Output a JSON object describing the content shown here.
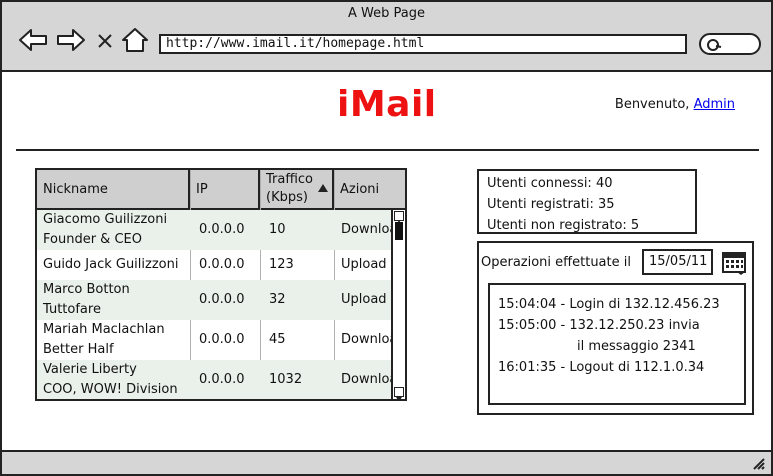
{
  "window": {
    "title": "A Web Page"
  },
  "browser": {
    "url": "http://www.imail.it/homepage.html",
    "icons": [
      "back-arrow-icon",
      "forward-arrow-icon",
      "close-x-icon",
      "home-icon",
      "search-icon"
    ]
  },
  "header": {
    "logo": "iMail",
    "welcome_prefix": "Benvenuto,",
    "user_link": "Admin",
    "logo_color": "#ee1111",
    "link_color": "#0000ee"
  },
  "table": {
    "columns": [
      "Nickname",
      "IP",
      "Traffico (Kbps)",
      "Azioni"
    ],
    "sort_column": "Traffico (Kbps)",
    "sort_direction": "ascending",
    "row_shade": "#eaf1ea",
    "rows": [
      {
        "nick1": "Giacomo Guilizzoni",
        "nick2": "Founder & CEO",
        "ip": "0.0.0.0",
        "traffic": "10",
        "action": "Download"
      },
      {
        "nick1": "Guido Jack Guilizzoni",
        "nick2": "",
        "ip": "0.0.0.0",
        "traffic": "123",
        "action": "Upload"
      },
      {
        "nick1": "Marco Botton",
        "nick2": "Tuttofare",
        "ip": "0.0.0.0",
        "traffic": "32",
        "action": "Upload"
      },
      {
        "nick1": "Mariah Maclachlan",
        "nick2": "Better Half",
        "ip": "0.0.0.0",
        "traffic": "45",
        "action": "Download"
      },
      {
        "nick1": "Valerie Liberty",
        "nick2": "COO, WOW! Division",
        "ip": "0.0.0.0",
        "traffic": "1032",
        "action": "Download"
      }
    ]
  },
  "stats": {
    "connected": "Utenti connessi: 40",
    "registered": "Utenti registrati: 35",
    "unregistered": "Utenti non registrato: 5"
  },
  "operations": {
    "label": "Operazioni effettuate il",
    "date": "15/05/11",
    "log": [
      "15:04:04 - Login di 132.12.456.23",
      "15:05:00 - 132.12.250.23 invia",
      "il messaggio 2341",
      "16:01:35 - Logout di 112.1.0.34"
    ]
  }
}
